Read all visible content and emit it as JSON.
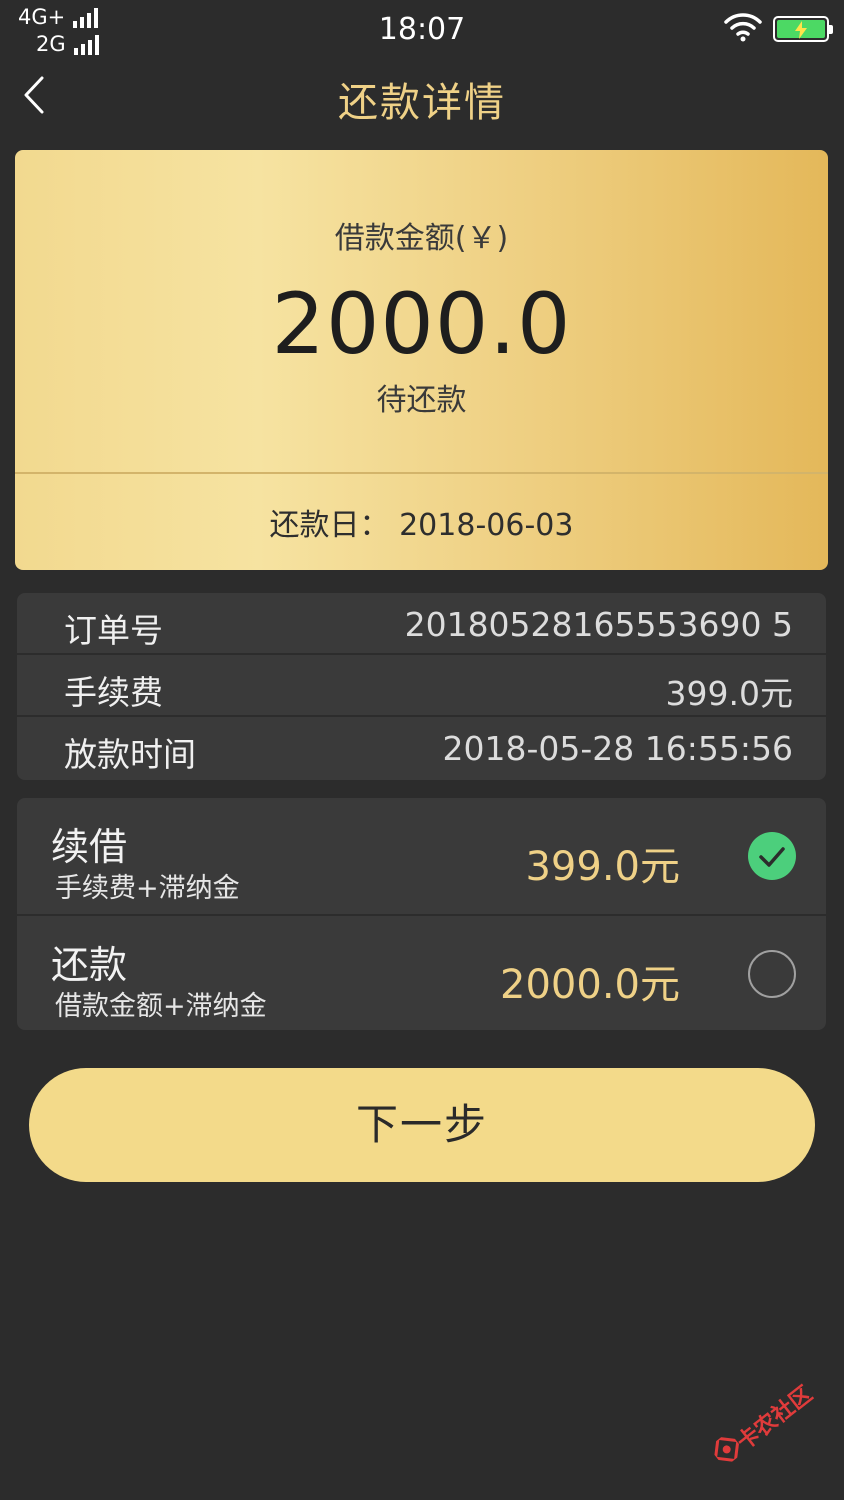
{
  "status_bar": {
    "network_primary": "4G+",
    "network_secondary": "2G",
    "time": "18:07"
  },
  "nav": {
    "title": "还款详情"
  },
  "loan_card": {
    "amount_label": "借款金额(￥)",
    "amount": "2000.0",
    "status": "待还款",
    "due_label": "还款日：",
    "due_date": "2018-06-03",
    "colors": {
      "gold_light": "#f6e3a1",
      "gold_dark": "#e4b85a"
    }
  },
  "details": [
    {
      "label": "订单号",
      "value": "20180528165553690 5"
    },
    {
      "label": "手续费",
      "value": "399.0元"
    },
    {
      "label": "放款时间",
      "value": "2018-05-28 16:55:56"
    }
  ],
  "options": [
    {
      "title": "续借",
      "subtitle": "手续费+滞纳金",
      "price": "399.0元",
      "selected": true
    },
    {
      "title": "还款",
      "subtitle": "借款金额+滞纳金",
      "price": "2000.0元",
      "selected": false
    }
  ],
  "next_button": {
    "label": "下一步"
  },
  "watermark": {
    "text": "卡农社区"
  },
  "colors": {
    "background": "#2c2c2c",
    "panel": "#3a3a3a",
    "accent_gold": "#efd187",
    "check_green": "#4ccf7c",
    "button": "#f3da8a"
  }
}
